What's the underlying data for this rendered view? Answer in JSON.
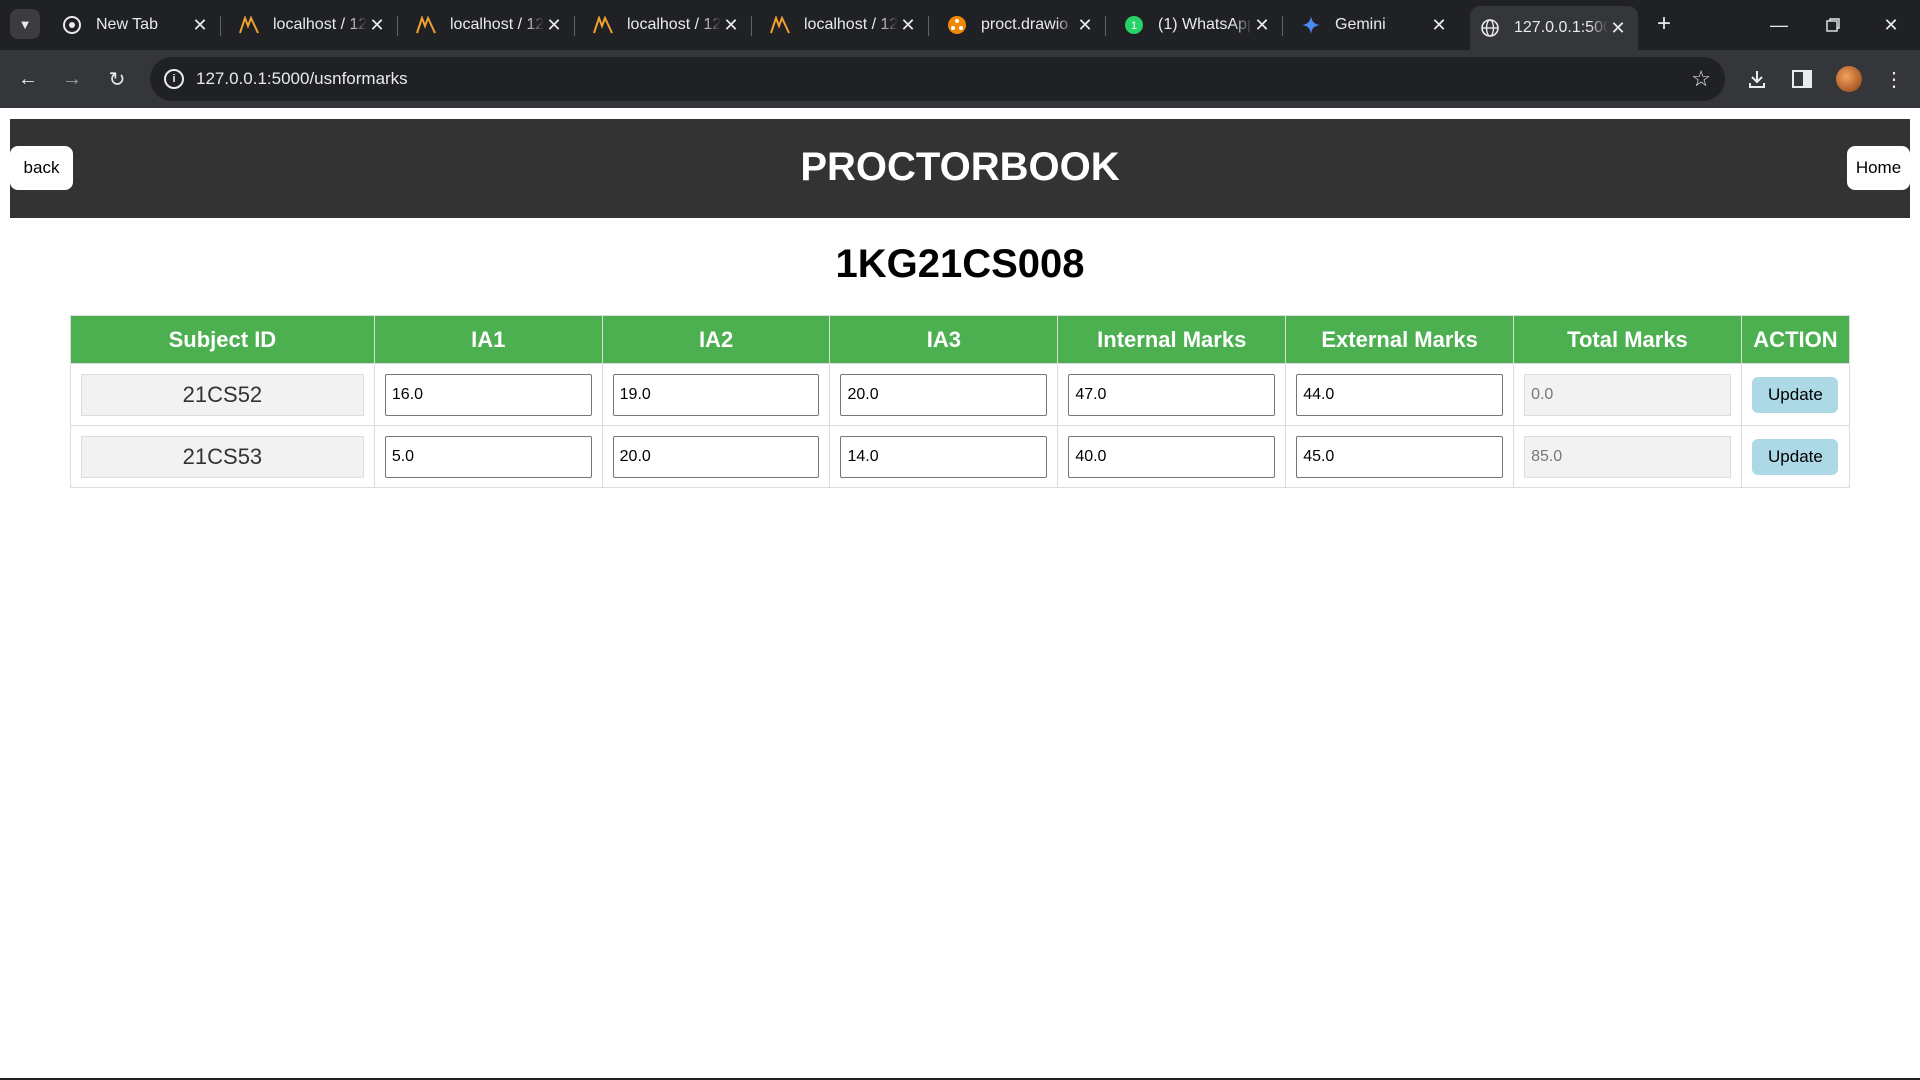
{
  "browser": {
    "tabs": [
      {
        "title": "New Tab",
        "icon": "chrome-icon",
        "active": false
      },
      {
        "title": "localhost / 12",
        "icon": "phpmyadmin-icon",
        "active": false
      },
      {
        "title": "localhost / 12",
        "icon": "phpmyadmin-icon",
        "active": false
      },
      {
        "title": "localhost / 12",
        "icon": "phpmyadmin-icon",
        "active": false
      },
      {
        "title": "localhost / 12",
        "icon": "phpmyadmin-icon",
        "active": false
      },
      {
        "title": "proct.drawio",
        "icon": "drawio-icon",
        "active": false
      },
      {
        "title": "(1) WhatsApp",
        "icon": "whatsapp-icon",
        "active": false
      },
      {
        "title": "Gemini",
        "icon": "gemini-icon",
        "active": false
      },
      {
        "title": "127.0.0.1:5000",
        "icon": "globe-icon",
        "active": true
      }
    ],
    "url": "127.0.0.1:5000/usnformarks"
  },
  "header": {
    "title": "PROCTORBOOK",
    "back_label": "back",
    "home_label": "Home"
  },
  "usn": "1KG21CS008",
  "table": {
    "columns": [
      "Subject ID",
      "IA1",
      "IA2",
      "IA3",
      "Internal Marks",
      "External Marks",
      "Total Marks",
      "ACTION"
    ],
    "rows": [
      {
        "subject_id": "21CS52",
        "ia1": "16.0",
        "ia2": "19.0",
        "ia3": "20.0",
        "internal": "47.0",
        "external": "44.0",
        "total": "0.0",
        "action": "Update"
      },
      {
        "subject_id": "21CS53",
        "ia1": "5.0",
        "ia2": "20.0",
        "ia3": "14.0",
        "internal": "40.0",
        "external": "45.0",
        "total": "85.0",
        "action": "Update"
      }
    ]
  }
}
